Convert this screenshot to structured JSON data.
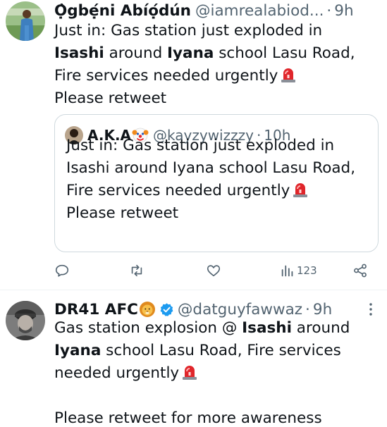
{
  "tweet1": {
    "author_name": "Ọ̀gbẹ́ni Abíọ́dún",
    "handle": "@iamrealabiod...",
    "separator": "·",
    "time": "9h",
    "lines": [
      [
        "Just in: Gas station just exploded in"
      ],
      [
        "Isashi",
        " around ",
        "Iyana",
        " school Lasu Road,"
      ],
      [
        "Fire services needed urgently"
      ],
      [
        "Please retweet"
      ]
    ],
    "line1": "Just in: Gas station just exploded in",
    "line2_b1": "Isashi",
    "line2_t1": " around ",
    "line2_b2": "Iyana",
    "line2_t2": " school Lasu Road,",
    "line3": "Fire services needed urgently",
    "line4": "Please retweet",
    "quote": {
      "author_name": "A.K.A",
      "handle": "@kayzywizzzy",
      "separator": "·",
      "time": "10h",
      "line1": "Just in: Gas station just exploded in",
      "line2": "Isashi around Iyana school Lasu Road,",
      "line3": "Fire services needed urgently",
      "line4": "Please retweet"
    },
    "actions": {
      "views_count": "123"
    }
  },
  "tweet2": {
    "author_name": "DR41 AFC",
    "handle": "@datguyfawwaz",
    "separator": "·",
    "time": "9h",
    "line1_t1": "Gas station explosion @ ",
    "line1_b1": "Isashi",
    "line1_t2": " around",
    "line2_b1": "Iyana",
    "line2_t1": " school Lasu Road, Fire services",
    "line3": "needed urgently",
    "line5": "Please retweet for more awareness"
  },
  "icons": {
    "siren": "police-car-light-emoji",
    "clown": "clown-face-emoji",
    "lion": "lion-face-emoji",
    "verified": "verified-badge",
    "more": "more-vertical-icon",
    "reply": "reply-icon",
    "retweet": "retweet-icon",
    "like": "heart-icon",
    "views": "views-icon",
    "share": "share-icon"
  },
  "colors": {
    "text": "#0f1419",
    "muted": "#536471",
    "verified": "#1d9bf0",
    "border": "#cfd9de"
  }
}
